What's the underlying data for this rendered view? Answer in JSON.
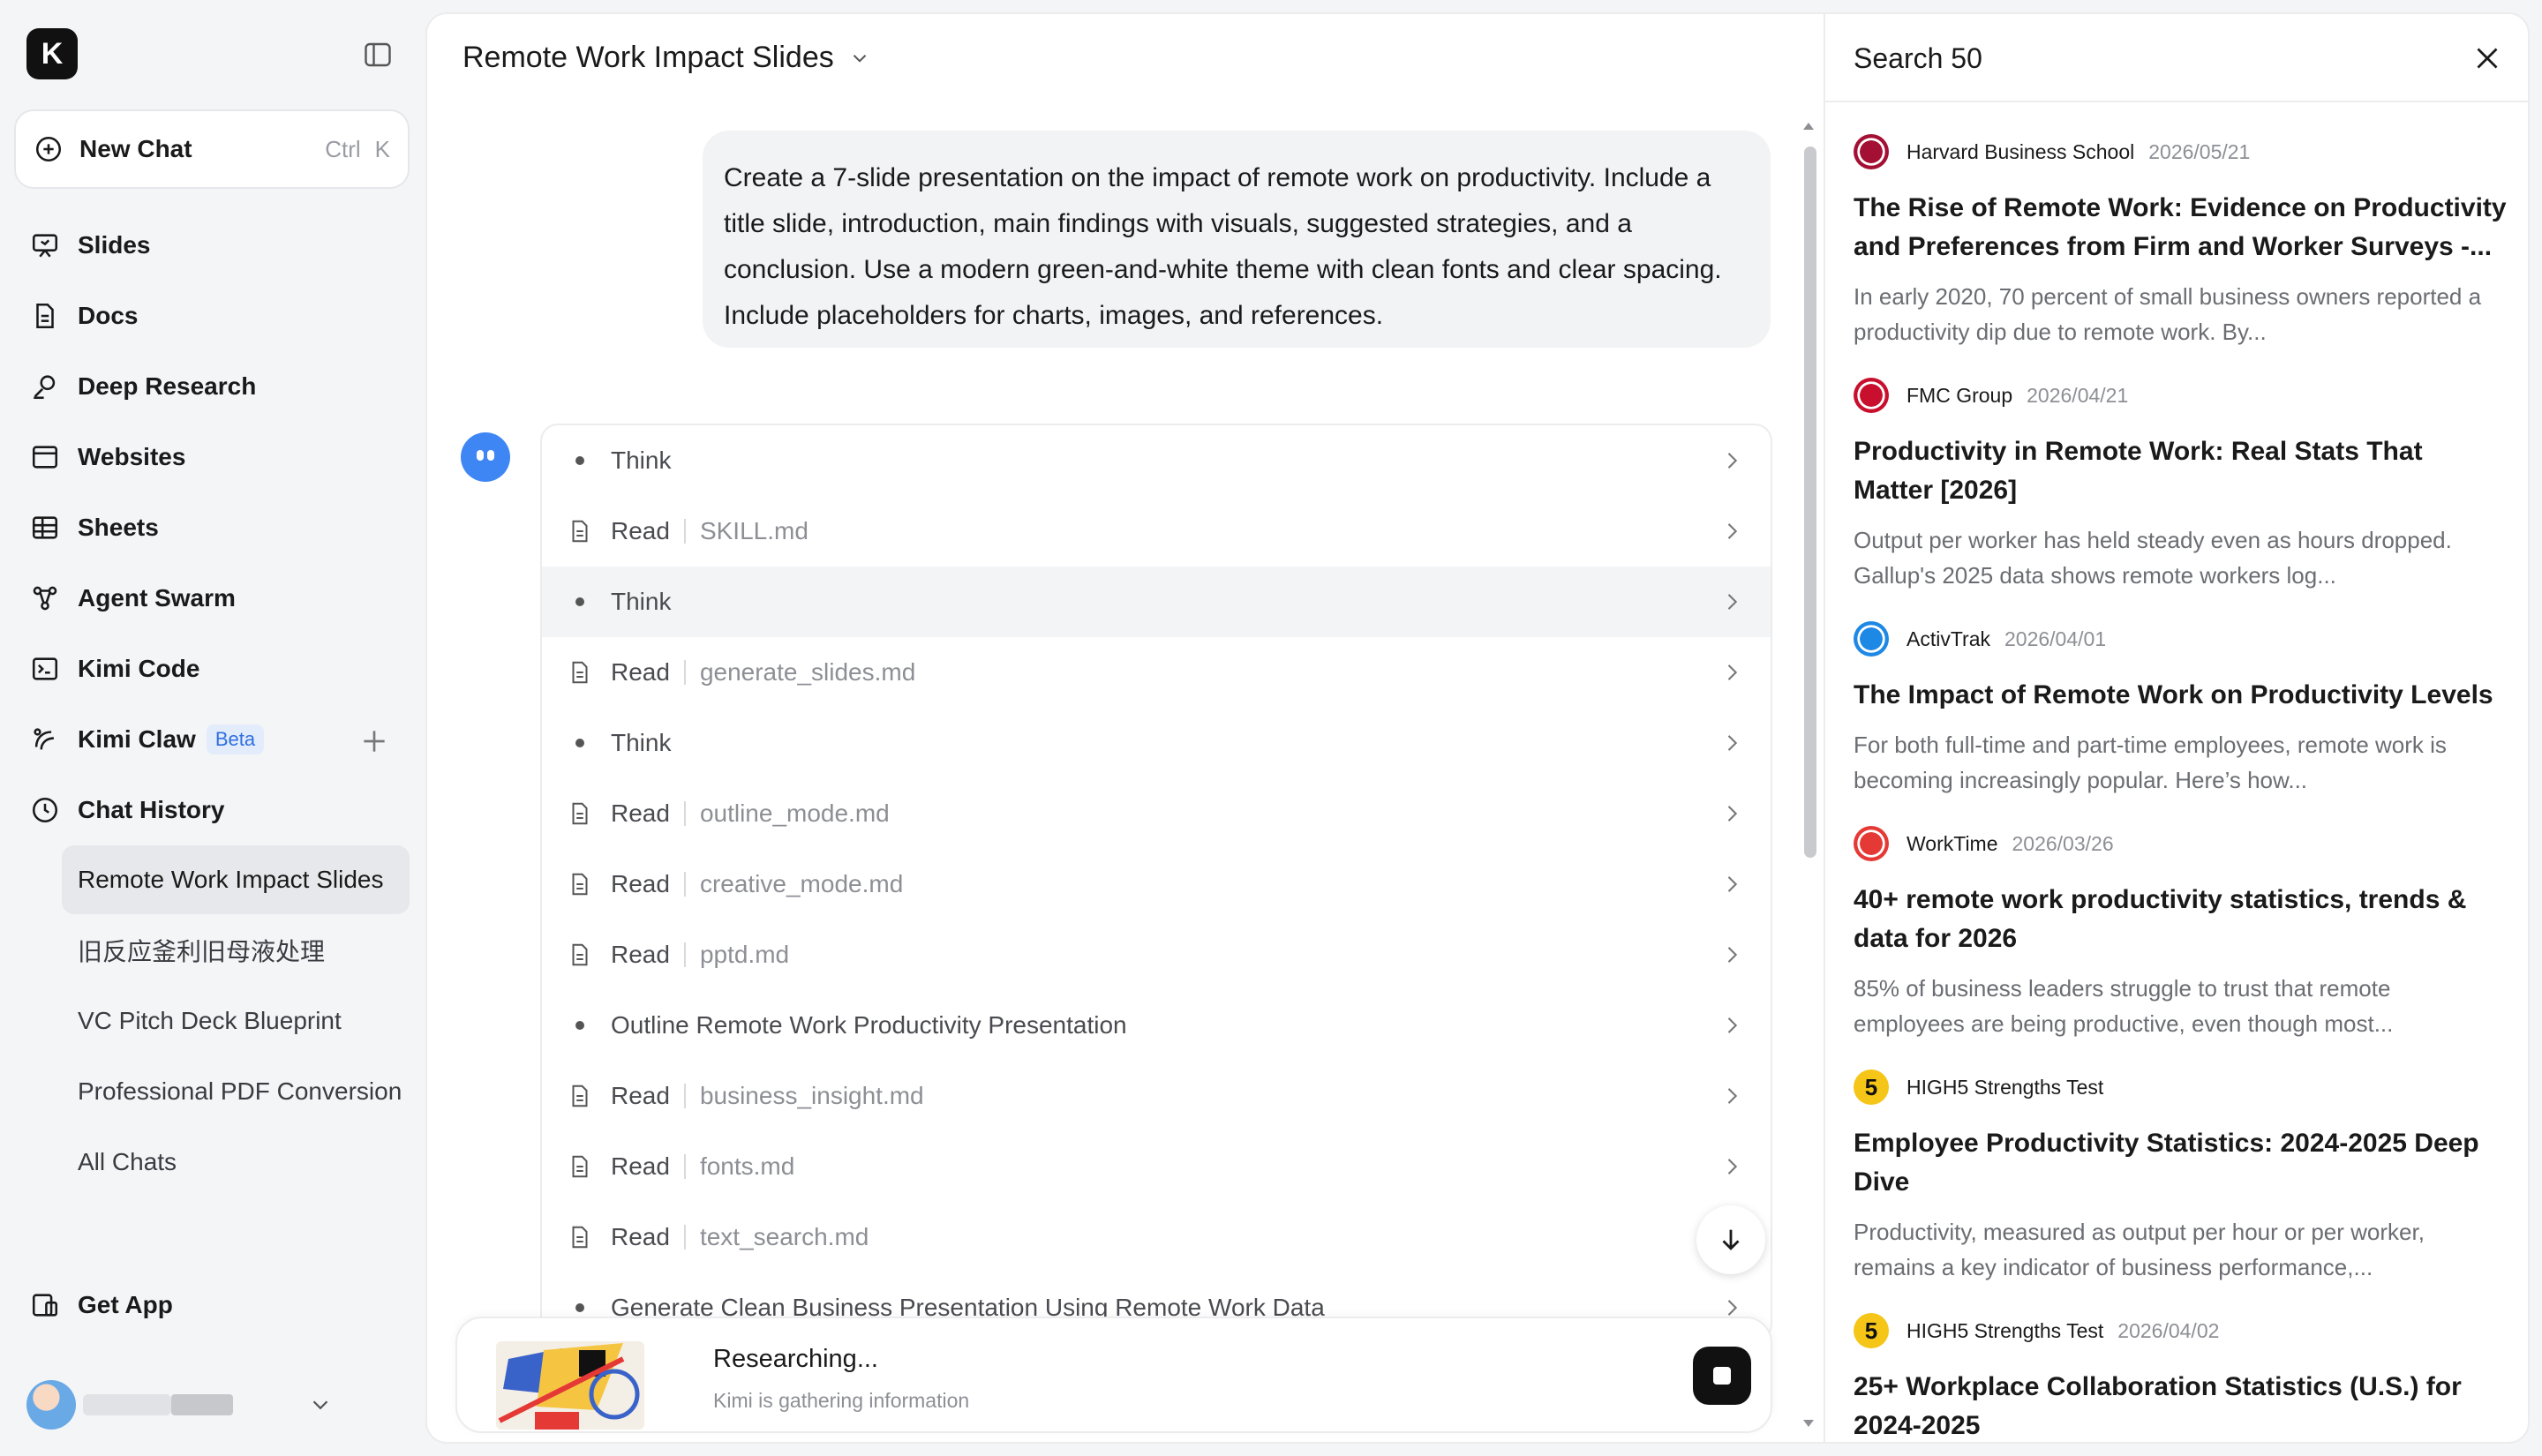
{
  "sidebar": {
    "logo": "K",
    "new_chat": {
      "label": "New Chat",
      "kbd1": "Ctrl",
      "kbd2": "K"
    },
    "nav": [
      {
        "label": "Slides",
        "icon": "slides-icon"
      },
      {
        "label": "Docs",
        "icon": "docs-icon"
      },
      {
        "label": "Deep Research",
        "icon": "deep-research-icon"
      },
      {
        "label": "Websites",
        "icon": "websites-icon"
      },
      {
        "label": "Sheets",
        "icon": "sheets-icon"
      },
      {
        "label": "Agent Swarm",
        "icon": "agent-swarm-icon"
      },
      {
        "label": "Kimi Code",
        "icon": "terminal-icon"
      },
      {
        "label": "Kimi Claw",
        "icon": "claw-icon",
        "badge": "Beta"
      },
      {
        "label": "Chat History",
        "icon": "clock-icon"
      }
    ],
    "history": [
      "Remote Work Impact Slides",
      "旧反应釜利旧母液处理",
      "VC Pitch Deck Blueprint",
      "Professional PDF Conversion",
      "All Chats"
    ],
    "get_app": "Get App"
  },
  "main": {
    "title": "Remote Work Impact Slides",
    "user_message": "Create a 7-slide presentation on the impact of remote work on productivity. Include a title slide, introduction, main findings with visuals, suggested strategies, and a conclusion. Use a modern green-and-white theme with clean fonts and clear spacing. Include placeholders for charts, images, and references.",
    "steps": [
      {
        "type": "think",
        "label": "Think",
        "arg": ""
      },
      {
        "type": "read",
        "label": "Read",
        "arg": "SKILL.md"
      },
      {
        "type": "think",
        "label": "Think",
        "arg": ""
      },
      {
        "type": "read",
        "label": "Read",
        "arg": "generate_slides.md"
      },
      {
        "type": "think",
        "label": "Think",
        "arg": ""
      },
      {
        "type": "read",
        "label": "Read",
        "arg": "outline_mode.md"
      },
      {
        "type": "read",
        "label": "Read",
        "arg": "creative_mode.md"
      },
      {
        "type": "read",
        "label": "Read",
        "arg": "pptd.md"
      },
      {
        "type": "think",
        "label": "Outline Remote Work Productivity Presentation",
        "arg": ""
      },
      {
        "type": "read",
        "label": "Read",
        "arg": "business_insight.md"
      },
      {
        "type": "read",
        "label": "Read",
        "arg": "fonts.md"
      },
      {
        "type": "read",
        "label": "Read",
        "arg": "text_search.md"
      },
      {
        "type": "think",
        "label": "Generate Clean Business Presentation Using Remote Work Data",
        "arg": ""
      }
    ],
    "status": {
      "title": "Researching...",
      "subtitle": "Kimi is gathering information"
    }
  },
  "search": {
    "title": "Search 50",
    "results": [
      {
        "source": "Harvard Business School",
        "date": "2026/05/21",
        "title": "The Rise of Remote Work: Evidence on Productivity and Preferences from Firm and Worker Surveys -...",
        "snippet": "In early 2020, 70 percent of small business owners reported a productivity dip due to remote work. By...",
        "icon_color": "#a41034",
        "icon": "hbs-shield-icon"
      },
      {
        "source": "FMC Group",
        "date": "2026/04/21",
        "title": "Productivity in Remote Work: Real Stats That Matter [2026]",
        "snippet": "Output per worker has held steady even as hours dropped. Gallup's 2025 data shows remote workers log...",
        "icon_color": "#c8102e",
        "icon": "fmc-dots-icon"
      },
      {
        "source": "ActivTrak",
        "date": "2026/04/01",
        "title": "The Impact of Remote Work on Productivity Levels",
        "snippet": "For both full-time and part-time employees, remote work is becoming increasingly popular. Here’s how...",
        "icon_color": "#1e88e5",
        "icon": "activtrak-icon"
      },
      {
        "source": "WorkTime",
        "date": "2026/03/26",
        "title": "40+ remote work productivity statistics, trends & data for 2026",
        "snippet": "85% of business leaders struggle to trust that remote employees are being productive, even though most...",
        "icon_color": "#e53935",
        "icon": "worktime-clock-icon"
      },
      {
        "source": "HIGH5 Strengths Test",
        "date": "",
        "title": "Employee Productivity Statistics: 2024-2025 Deep Dive",
        "snippet": "Productivity, measured as output per hour or per worker, remains a key indicator of business performance,...",
        "icon_color": "#f5c518",
        "icon": "high5-icon",
        "icon_text": "5"
      },
      {
        "source": "HIGH5 Strengths Test",
        "date": "2026/04/02",
        "title": "25+ Workplace Collaboration Statistics (U.S.) for 2024-2025",
        "snippet": "",
        "icon_color": "#f5c518",
        "icon": "high5-icon",
        "icon_text": "5"
      }
    ]
  }
}
